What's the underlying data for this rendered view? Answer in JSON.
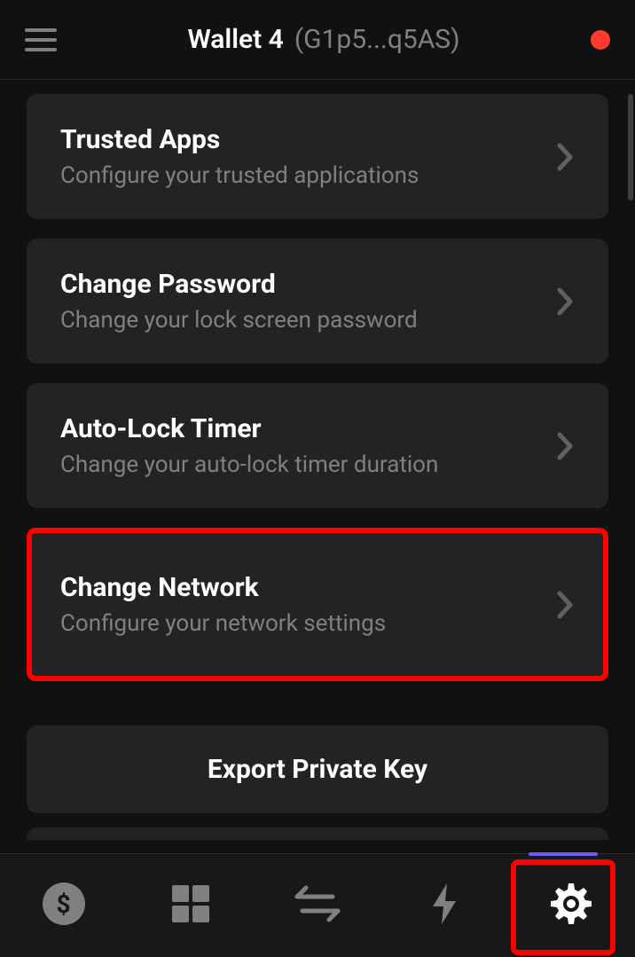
{
  "header": {
    "wallet_name": "Wallet 4",
    "wallet_address": "(G1p5...q5AS)"
  },
  "settings": {
    "items": [
      {
        "title": "Trusted Apps",
        "subtitle": "Configure your trusted applications",
        "highlighted": false
      },
      {
        "title": "Change Password",
        "subtitle": "Change your lock screen password",
        "highlighted": false
      },
      {
        "title": "Auto-Lock Timer",
        "subtitle": "Change your auto-lock timer duration",
        "highlighted": false
      },
      {
        "title": "Change Network",
        "subtitle": "Configure your network settings",
        "highlighted": true
      }
    ],
    "export_label": "Export Private Key"
  },
  "colors": {
    "background": "#111111",
    "card": "#232323",
    "status_red": "#ff3b30",
    "highlight_red": "#ff0000",
    "active_purple": "#6b5bff"
  }
}
